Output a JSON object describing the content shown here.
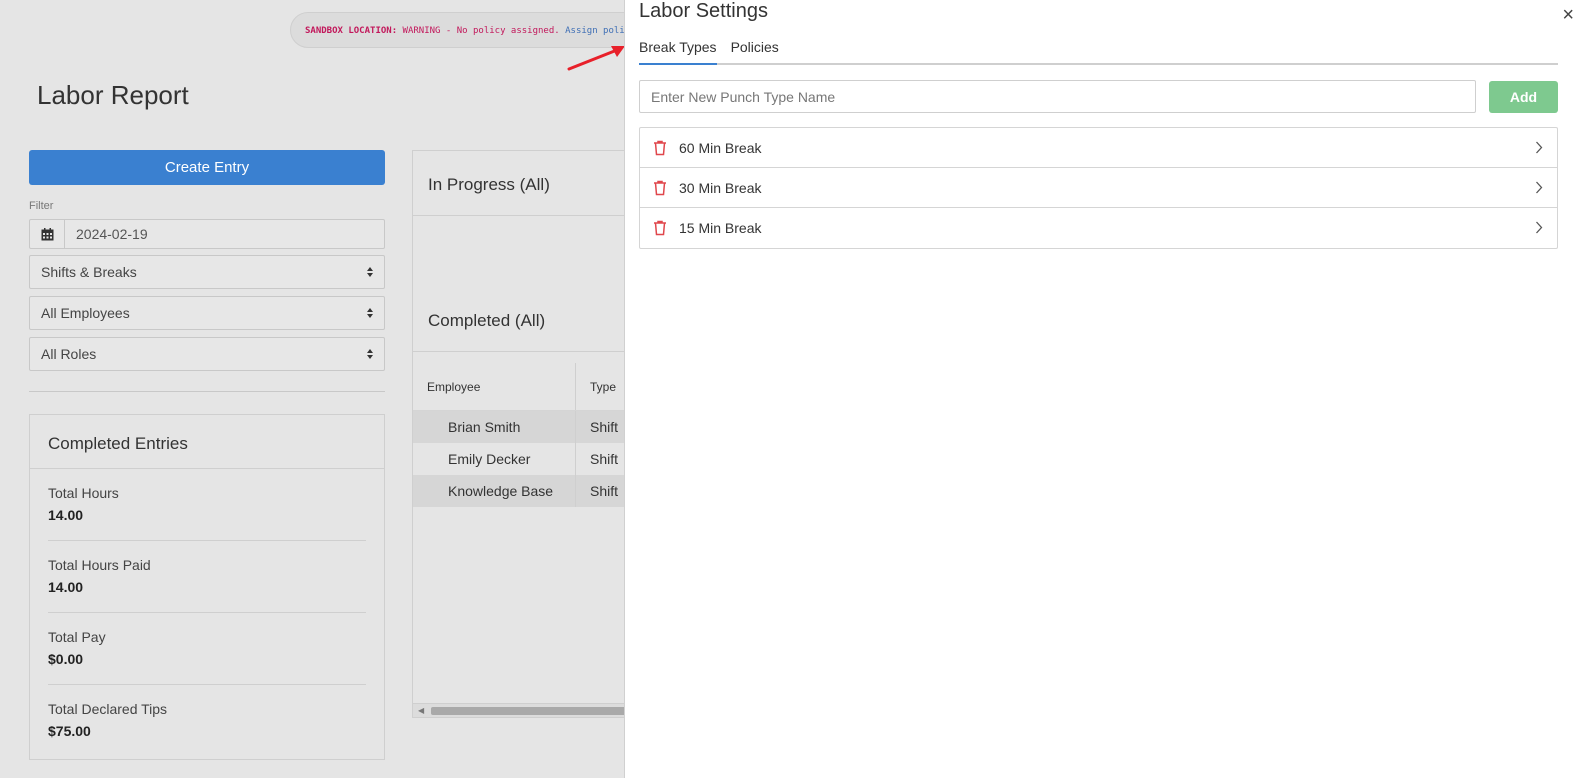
{
  "banner": {
    "tag": "SANDBOX LOCATION:",
    "warning": "WARNING - No policy assigned.",
    "link": "Assign policy"
  },
  "page": {
    "title": "Labor Report",
    "create_label": "Create Entry",
    "filter_label": "Filter",
    "date_value": "2024-02-19",
    "selects": [
      "Shifts & Breaks",
      "All Employees",
      "All Roles"
    ]
  },
  "completed_card": {
    "title": "Completed Entries",
    "stats": [
      {
        "label": "Total Hours",
        "value": "14.00"
      },
      {
        "label": "Total Hours Paid",
        "value": "14.00"
      },
      {
        "label": "Total Pay",
        "value": "$0.00"
      },
      {
        "label": "Total Declared Tips",
        "value": "$75.00"
      }
    ]
  },
  "main": {
    "in_progress_title": "In Progress (All)",
    "completed_title": "Completed (All)",
    "columns": [
      "Employee",
      "Type"
    ],
    "rows": [
      {
        "employee": "Brian Smith",
        "type": "Shift"
      },
      {
        "employee": "Emily Decker",
        "type": "Shift"
      },
      {
        "employee": "Knowledge Base",
        "type": "Shift"
      }
    ]
  },
  "drawer": {
    "title": "Labor Settings",
    "close_label": "×",
    "tabs": [
      "Break Types",
      "Policies"
    ],
    "active_tab": "Break Types",
    "input_placeholder": "Enter New Punch Type Name",
    "add_label": "Add",
    "break_types": [
      "60 Min Break",
      "30 Min Break",
      "15 Min Break"
    ]
  },
  "colors": {
    "primary": "#3a80d0",
    "add_button": "#7ec98f",
    "danger": "#e0474c",
    "annotation_arrow": "#e8202a"
  }
}
